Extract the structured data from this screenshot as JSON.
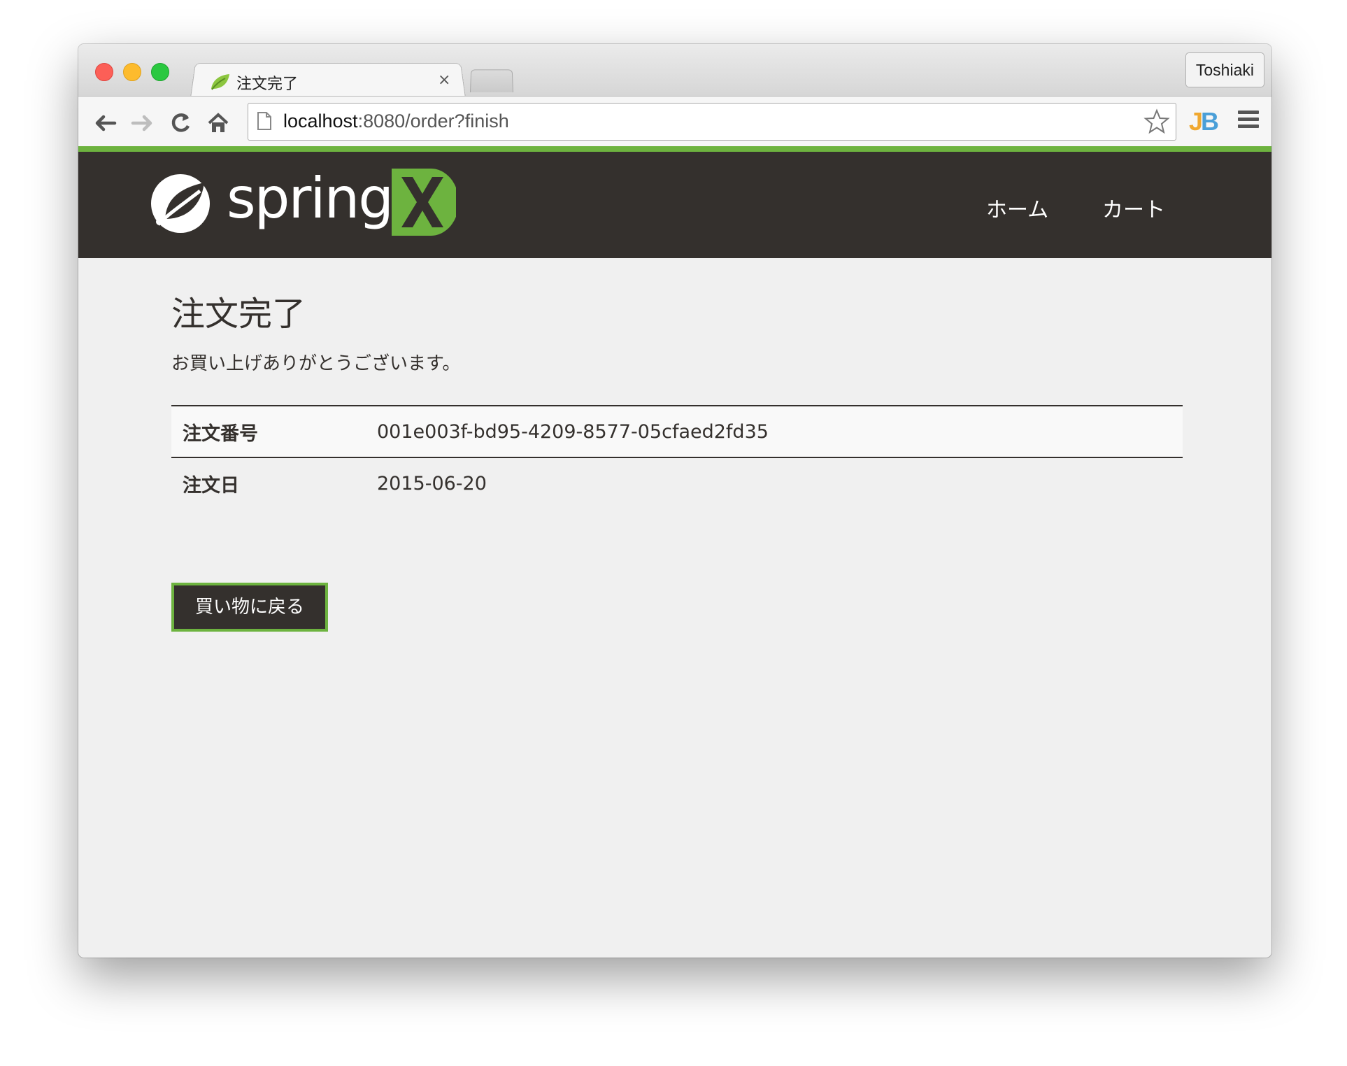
{
  "browser": {
    "tab_title": "注文完了",
    "tab_close": "×",
    "profile_name": "Toshiaki",
    "url_host": "localhost",
    "url_rest": ":8080/order?finish",
    "extension_label_j": "J",
    "extension_label_b": "B"
  },
  "header": {
    "logo_text": "spring",
    "nav": [
      {
        "label": "ホーム"
      },
      {
        "label": "カート"
      }
    ]
  },
  "main": {
    "title": "注文完了",
    "thanks": "お買い上げありがとうございます。",
    "details": [
      {
        "label": "注文番号",
        "value": "001e003f-bd95-4209-8577-05cfaed2fd35"
      },
      {
        "label": "注文日",
        "value": "2015-06-20"
      }
    ],
    "back_button": "買い物に戻る"
  },
  "colors": {
    "header_bg": "#34302d",
    "accent_green": "#6db33f",
    "page_bg": "#f0f0f0"
  }
}
